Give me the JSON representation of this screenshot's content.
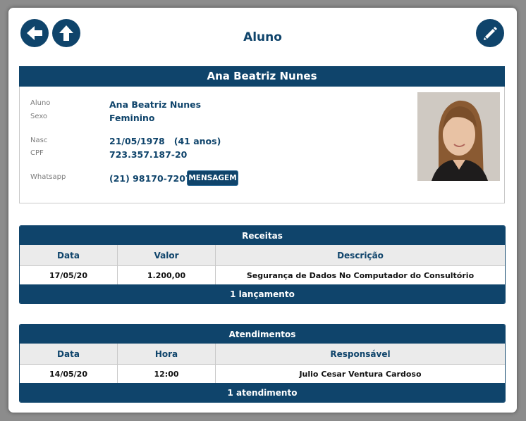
{
  "header": {
    "title": "Aluno",
    "back_icon": "arrow-left-icon",
    "up_icon": "arrow-up-icon",
    "edit_icon": "pencil-icon"
  },
  "student": {
    "name": "Ana Beatriz Nunes",
    "fields": {
      "aluno_label": "Aluno",
      "aluno_value": "Ana Beatriz Nunes",
      "sexo_label": "Sexo",
      "sexo_value": "Feminino",
      "nasc_label": "Nasc",
      "nasc_value": "21/05/1978   (41 anos)",
      "cpf_label": "CPF",
      "cpf_value": "723.357.187-20",
      "whatsapp_label": "Whatsapp",
      "whatsapp_value": "(21) 98170-7207"
    },
    "message_button": "MENSAGEM"
  },
  "receitas": {
    "title": "Receitas",
    "columns": [
      "Data",
      "Valor",
      "Descrição"
    ],
    "rows": [
      [
        "17/05/20",
        "1.200,00",
        "Segurança de Dados No Computador do Consultório"
      ]
    ],
    "footer": "1 lançamento"
  },
  "atendimentos": {
    "title": "Atendimentos",
    "columns": [
      "Data",
      "Hora",
      "Responsável"
    ],
    "rows": [
      [
        "14/05/20",
        "12:00",
        "Julio Cesar Ventura Cardoso"
      ]
    ],
    "footer": "1 atendimento"
  },
  "colors": {
    "primary": "#0f446b",
    "header_row": "#ebebeb",
    "background": "#8c8c8c"
  }
}
